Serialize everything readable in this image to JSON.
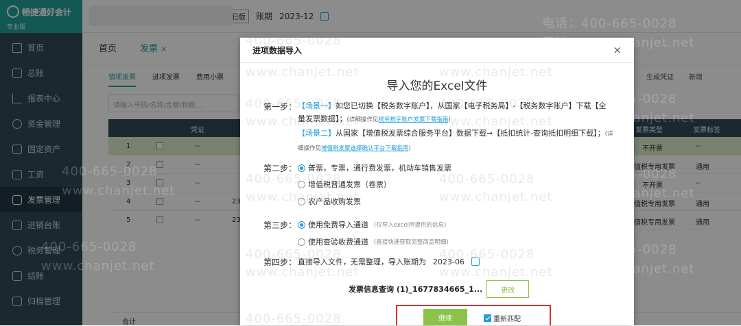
{
  "brand": {
    "name": "畅捷通好会计",
    "edition": "专业版"
  },
  "sidebar": {
    "items": [
      {
        "label": "首页",
        "icon": "home-icon"
      },
      {
        "label": "总账",
        "icon": "ledger-icon"
      },
      {
        "label": "报表中心",
        "icon": "report-chart-icon"
      },
      {
        "label": "资金管理",
        "icon": "fund-icon"
      },
      {
        "label": "固定资产",
        "icon": "asset-icon"
      },
      {
        "label": "工资",
        "icon": "salary-icon"
      },
      {
        "label": "发票管理",
        "icon": "invoice-icon",
        "active": true
      },
      {
        "label": "进销台账",
        "icon": "inventory-ledger-icon"
      },
      {
        "label": "税务管理",
        "icon": "tax-icon"
      },
      {
        "label": "结账",
        "icon": "closing-icon"
      },
      {
        "label": "归档管理",
        "icon": "archive-icon"
      }
    ]
  },
  "topbar": {
    "old_version": "切到旧版",
    "period_label": "账期",
    "period_value": "2023-12"
  },
  "page_tabs": {
    "home": "首页",
    "invoice": "发票",
    "close": "×"
  },
  "sub_tabs": [
    "销项发票",
    "进项发票",
    "费用小票"
  ],
  "search": {
    "placeholder": "请输入号码/名称/金额/税额..."
  },
  "actions": {
    "generate_voucher": "生成凭证",
    "add": "新增"
  },
  "grid": {
    "headers": {
      "voucher": "凭证",
      "invoice_type": "发票类型",
      "invoice_tag": "发票标签"
    },
    "rows": [
      {
        "no": "1",
        "voucher": "--",
        "type": "不开票",
        "tag": "--"
      },
      {
        "no": "2",
        "voucher": "--",
        "type": "值税专用发票",
        "tag": "通用"
      },
      {
        "no": "3",
        "voucher": "--",
        "type": "不开票",
        "tag": "--"
      },
      {
        "no": "4",
        "voucher": "--",
        "extra": "23",
        "type": "值税专用发票",
        "tag": "通用"
      },
      {
        "no": "5",
        "voucher": "--",
        "extra": "23",
        "type": "值税专用发票",
        "tag": "通用"
      }
    ],
    "total": "合计"
  },
  "watermark": {
    "phone": "400-665-0028",
    "phone_prefix": "电话：",
    "site": "www.chanjet.net",
    "site_prefix": "网址："
  },
  "modal": {
    "title": "进项数据导入",
    "close": "×",
    "heading": "导入您的Excel文件",
    "step1": {
      "label": "第一步：",
      "s1_tag": "【场景一】",
      "s1_text_a": "如您已切换【税务数字账户】，从国家【电子税务局】-【税务数字账户】下载【全量发票数据】；",
      "s1_note": "(详细操作见",
      "s1_link": "税务数字账户发票下载指南",
      "s1_note_end": ")",
      "s2_tag": "【场景二】",
      "s2_text": "从国家【增值税发票综合服务平台】数据下载➞【抵扣统计-查询抵扣明细下载】；",
      "s2_note": "(详细操作见",
      "s2_link": "增值税发票选择确认平台下载指南",
      "s2_note_end": ")"
    },
    "step2": {
      "label": "第二步：",
      "options": [
        "普票，专票，通行费发票，机动车销售发票",
        "增值税普通发票（卷票）",
        "农产品收购发票"
      ],
      "selected": 0
    },
    "step3": {
      "label": "第三步：",
      "options": [
        {
          "text": "使用免费导入通道",
          "note": "(仅导入excel所提供的信息)"
        },
        {
          "text": "使用查验收费通道",
          "note": "(直接快速获取完整商品明细)"
        }
      ],
      "selected": 0
    },
    "step4": {
      "label": "第四步：",
      "text": "直接导入文件，无需整理，导入账期为",
      "period": "2023-06"
    },
    "file": {
      "name": "发票信息查询 (1)_1677834665_1...",
      "change": "更改"
    },
    "continue": "继续",
    "rematch": "重新匹配"
  },
  "colors": {
    "brand": "#23a19a",
    "sidebar": "#2f4b57",
    "link": "#1e9fd6",
    "green_btn": "#8bc34a",
    "highlight": "#d9302b"
  }
}
